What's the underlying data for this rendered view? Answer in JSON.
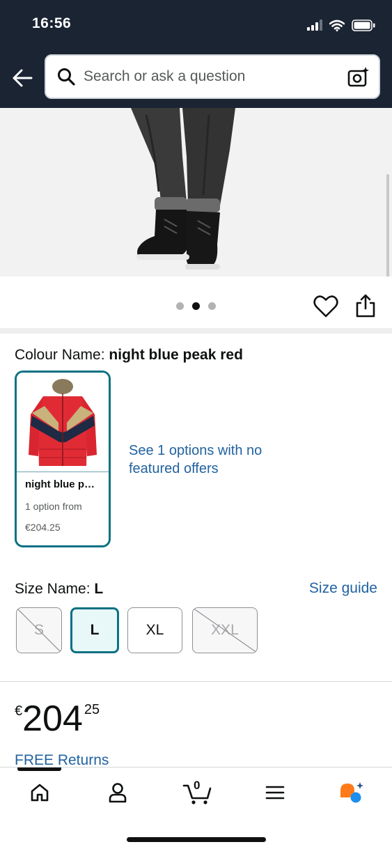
{
  "status_bar": {
    "time": "16:56",
    "icons": [
      "signal-icon",
      "wifi-icon",
      "battery-icon"
    ]
  },
  "header": {
    "back_icon": "arrow-left-icon",
    "search": {
      "placeholder": "Search or ask a question",
      "value": "",
      "icon": "search-icon",
      "camera_icon": "camera-sparkle-icon"
    }
  },
  "image_carousel": {
    "slide_count": 3,
    "active_index": 1,
    "wishlist_icon": "heart-icon",
    "share_icon": "share-icon"
  },
  "colour": {
    "label": "Colour Name:",
    "value": "night blue peak red",
    "swatch": {
      "name": "night blue p…",
      "sub": "1 option from",
      "price": "€204.25"
    },
    "see_options": "See 1 options with no featured offers"
  },
  "size": {
    "label": "Size Name:",
    "value": "L",
    "guide": "Size guide",
    "options": [
      {
        "label": "S",
        "state": "unavailable"
      },
      {
        "label": "L",
        "state": "selected"
      },
      {
        "label": "XL",
        "state": "available"
      },
      {
        "label": "XXL",
        "state": "unavailable"
      }
    ]
  },
  "price": {
    "currency": "€",
    "whole": "204",
    "fraction": "25",
    "free_returns": "FREE Returns"
  },
  "bottom_nav": {
    "items": [
      "home-icon",
      "account-icon",
      "cart-icon",
      "menu-icon",
      "rufus-icon"
    ],
    "cart_count": "0"
  },
  "colors": {
    "header_bg": "#1b2433",
    "accent_teal": "#0b7184",
    "link_blue": "#2162a1"
  }
}
